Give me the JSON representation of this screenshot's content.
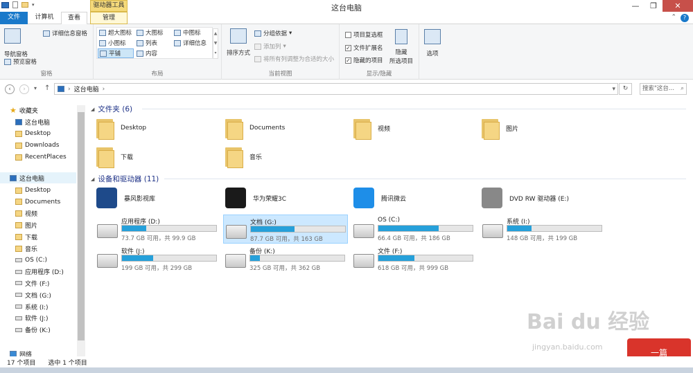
{
  "window": {
    "title": "这台电脑",
    "tool_tab_header": "驱动器工具",
    "minimize": "—",
    "maximize": "❐",
    "close": "✕"
  },
  "tabs": {
    "file": "文件",
    "computer": "计算机",
    "view": "查看",
    "manage": "管理"
  },
  "ribbon": {
    "chevron": "⌃",
    "help": "?",
    "panes": {
      "label": "窗格",
      "nav_pane": "导航窗格",
      "preview_pane": "预览窗格",
      "details_pane": "详细信息窗格"
    },
    "layout": {
      "label": "布局",
      "xl_icons": "超大图标",
      "large_icons": "大图标",
      "medium_icons": "中图标",
      "small_icons": "小图标",
      "list": "列表",
      "details": "详细信息",
      "tiles": "平铺",
      "content": "内容"
    },
    "current_view": {
      "label": "当前视图",
      "sort_by": "排序方式",
      "group_by": "分组依据",
      "add_column": "添加列",
      "fit_columns": "将所有列调整为合适的大小"
    },
    "show_hide": {
      "label": "显示/隐藏",
      "item_checkboxes": "项目复选框",
      "file_extensions": "文件扩展名",
      "hidden_items": "隐藏的项目",
      "hide_selected_line1": "隐藏",
      "hide_selected_line2": "所选项目"
    },
    "options": "选项"
  },
  "address": {
    "back": "‹",
    "forward": "›",
    "recent": "▾",
    "up": "↑",
    "path": "这台电脑",
    "sep": "›",
    "dropdown": "▾",
    "refresh": "↻",
    "search_placeholder": "搜索\"这台...",
    "search_icon": "⌕"
  },
  "nav": {
    "favorites": "收藏夹",
    "fav_items": [
      "这台电脑",
      "Desktop",
      "Downloads",
      "RecentPlaces"
    ],
    "this_pc": "这台电脑",
    "pc_items": [
      "Desktop",
      "Documents",
      "视频",
      "图片",
      "下载",
      "音乐",
      "OS (C:)",
      "应用程序 (D:)",
      "文件 (F:)",
      "文档 (G:)",
      "系统 (I:)",
      "软件 (J:)",
      "备份 (K:)"
    ],
    "network": "网络"
  },
  "content": {
    "folders_header": "文件夹 (6)",
    "folders": [
      "Desktop",
      "Documents",
      "视频",
      "图片",
      "下载",
      "音乐"
    ],
    "devices_header": "设备和驱动器 (11)",
    "devices": [
      "暴风影视库",
      "华为荣耀3C",
      "腾讯微云",
      "DVD RW 驱动器 (E:)"
    ],
    "drives": [
      {
        "name": "应用程序 (D:)",
        "cap": "73.7 GB 可用，共 99.9 GB",
        "used": 0.26
      },
      {
        "name": "文档 (G:)",
        "cap": "87.7 GB 可用，共 163 GB",
        "used": 0.46
      },
      {
        "name": "OS (C:)",
        "cap": "66.4 GB 可用，共 186 GB",
        "used": 0.64
      },
      {
        "name": "系统 (I:)",
        "cap": "148 GB 可用，共 199 GB",
        "used": 0.26
      },
      {
        "name": "软件 (J:)",
        "cap": "199 GB 可用，共 299 GB",
        "used": 0.33
      },
      {
        "name": "备份 (K:)",
        "cap": "325 GB 可用，共 362 GB",
        "used": 0.1
      },
      {
        "name": "文件 (F:)",
        "cap": "618 GB 可用，共 999 GB",
        "used": 0.38
      }
    ]
  },
  "status": {
    "count": "17 个项目",
    "selected": "选中 1 个项目"
  },
  "watermark": {
    "main": "Bai du 经验",
    "sub": "jingyan.baidu.com",
    "badge": "一篇"
  },
  "colors": {
    "accent": "#1979ca",
    "selection": "#cce8ff",
    "bar": "#26a0da"
  }
}
